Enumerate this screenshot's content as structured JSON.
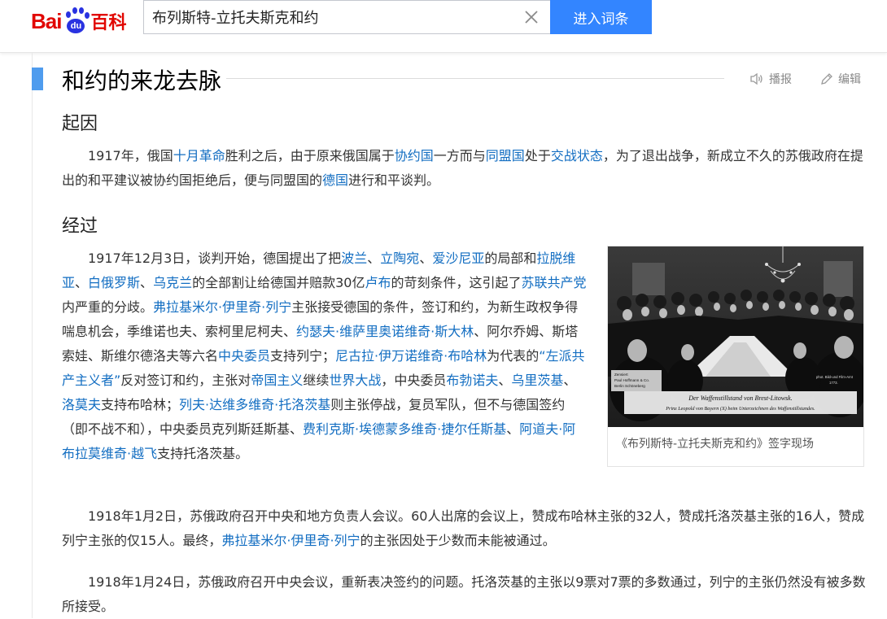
{
  "header": {
    "logo_text_left": "Bai",
    "logo_paw_text": "du",
    "logo_text_right": "百科",
    "search_value": "布列斯特-立托夫斯克和约",
    "search_button_label": "进入词条"
  },
  "section": {
    "title": "和约的来龙去脉",
    "listen_label": "播报",
    "edit_label": "编辑"
  },
  "cause": {
    "heading": "起因",
    "paragraph": [
      {
        "t": "1917年，俄国"
      },
      {
        "t": "十月革命",
        "link": true
      },
      {
        "t": "胜利之后，由于原来俄国属于"
      },
      {
        "t": "协约国",
        "link": true
      },
      {
        "t": "一方而与"
      },
      {
        "t": "同盟国",
        "link": true
      },
      {
        "t": "处于"
      },
      {
        "t": "交战状态",
        "link": true
      },
      {
        "t": "，为了退出战争，新成立不久的苏俄政府在提出的和平建议被协约国拒绝后，便与同盟国的"
      },
      {
        "t": "德国",
        "link": true
      },
      {
        "t": "进行和平谈判。"
      }
    ]
  },
  "process": {
    "heading": "经过",
    "paragraph1": [
      {
        "t": "1917年12月3日，谈判开始，德国提出了把"
      },
      {
        "t": "波兰",
        "link": true
      },
      {
        "t": "、"
      },
      {
        "t": "立陶宛",
        "link": true
      },
      {
        "t": "、"
      },
      {
        "t": "爱沙尼亚",
        "link": true
      },
      {
        "t": "的局部和"
      },
      {
        "t": "拉脱维亚",
        "link": true
      },
      {
        "t": "、"
      },
      {
        "t": "白俄罗斯",
        "link": true
      },
      {
        "t": "、"
      },
      {
        "t": "乌克兰",
        "link": true
      },
      {
        "t": "的全部割让给德国并赔款30亿"
      },
      {
        "t": "卢布",
        "link": true
      },
      {
        "t": "的苛刻条件，这引起了"
      },
      {
        "t": "苏联共产党",
        "link": true
      },
      {
        "t": "内严重的分歧。"
      },
      {
        "t": "弗拉基米尔·伊里奇·列宁",
        "link": true
      },
      {
        "t": "主张接受德国的条件，签订和约，为新生政权争得喘息机会，季维诺也夫、索柯里尼柯夫、"
      },
      {
        "t": "约瑟夫·维萨里奥诺维奇·斯大林",
        "link": true
      },
      {
        "t": "、阿尔乔姆、斯塔索娃、斯维尔德洛夫等六名"
      },
      {
        "t": "中央委员",
        "link": true
      },
      {
        "t": "支持列宁；"
      },
      {
        "t": "尼古拉·伊万诺维奇·布哈林",
        "link": true
      },
      {
        "t": "为代表的"
      },
      {
        "t": "“左派共产主义者”",
        "link": true
      },
      {
        "t": "反对签订和约，主张对"
      },
      {
        "t": "帝国主义",
        "link": true
      },
      {
        "t": "继续"
      },
      {
        "t": "世界大战",
        "link": true
      },
      {
        "t": "，中央委员"
      },
      {
        "t": "布勃诺夫",
        "link": true
      },
      {
        "t": "、"
      },
      {
        "t": "乌里茨基",
        "link": true
      },
      {
        "t": "、"
      },
      {
        "t": "洛莫夫",
        "link": true
      },
      {
        "t": "支持布哈林；"
      },
      {
        "t": "列夫·达维多维奇·托洛茨基",
        "link": true
      },
      {
        "t": "则主张停战，复员军队，但不与德国签约（即不战不和），中央委员克列斯廷斯基、"
      },
      {
        "t": "费利克斯·埃德蒙多维奇·捷尔任斯基",
        "link": true
      },
      {
        "t": "、"
      },
      {
        "t": "阿道夫·阿布拉莫维奇·越飞",
        "link": true
      },
      {
        "t": "支持托洛茨基。"
      }
    ],
    "paragraph2": [
      {
        "t": "1918年1月2日，苏俄政府召开中央和地方负责人会议。60人出席的会议上，赞成布哈林主张的32人，赞成托洛茨基主张的16人，赞成列宁主张的仅15人。最终，"
      },
      {
        "t": "弗拉基米尔·伊里奇·列宁",
        "link": true
      },
      {
        "t": "的主张因处于少数而未能被通过。"
      }
    ],
    "paragraph3": [
      {
        "t": "1918年1月24日，苏俄政府召开中央会议，重新表决签约的问题。托洛茨基的主张以9票对7票的多数通过，列宁的主张仍然没有被多数所接受。"
      }
    ]
  },
  "photo": {
    "caption": "《布列斯特-立托夫斯克和约》签字现场",
    "inscription_line1": "Der Waffenstillstand von Brest-Litowsk.",
    "inscription_line2": "Prinz Leopold von Bayern (X) beim Unterzeichnen des Waffenstillstandes.",
    "stamp_left_line1": "Zensiert",
    "stamp_left_line2": "Paul Hoffmann & Co.",
    "stamp_left_line3": "Berlin Schöneberg",
    "stamp_right_line1": "phot. Bild-und Film-Amt",
    "stamp_right_line2": "1773."
  },
  "colors": {
    "link": "#136ec2",
    "accent_marker": "#4f9cee",
    "search_button": "#3385ff",
    "logo_red": "#e10601",
    "logo_blue": "#2932e1"
  }
}
